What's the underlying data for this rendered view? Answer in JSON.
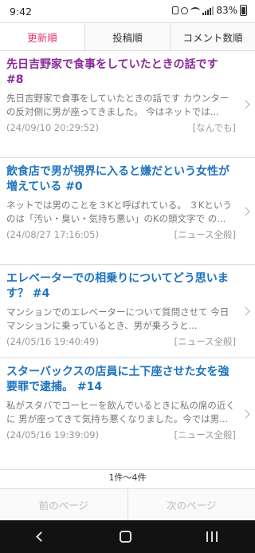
{
  "status": {
    "time": "9:42",
    "battery": "83%",
    "icons": [
      "notification-icon",
      "alarm-icon",
      "wifi-icon",
      "signal-icon",
      "battery-icon"
    ]
  },
  "tabs": [
    {
      "label": "更新順",
      "active": true
    },
    {
      "label": "投稿順",
      "active": false
    },
    {
      "label": "コメント数順",
      "active": false
    }
  ],
  "items": [
    {
      "title": "先日吉野家で食事をしていたときの話です #8",
      "body": "先日吉野家で食事をしていたときの話です カウンターの反対側に男が座ってきました。 今はネットでは...",
      "date": "(24/09/10 20:29:52)",
      "category": "[なんでも]"
    },
    {
      "title": "飲食店で男が視界に入ると嫌だという女性が増えている #0",
      "body": "ネットでは男のことを３Kと呼ばれている。 ３Kというのは「汚い・臭い・気持ち悪い」のKの頭文字で の...",
      "date": "(24/08/27 17:16:05)",
      "category": "[ニュース全般]"
    },
    {
      "title": "エレベーターでの相乗りについてどう思います？ #4",
      "body": "マンションでのエレベーターについて質問させて 今日マンションに乗っているとき、男が乗ろうと...",
      "date": "(24/05/16 19:40:49)",
      "category": "[ニュース全般]"
    },
    {
      "title": "スターバックスの店員に土下座させた女を強要罪で逮捕。 #14",
      "body": "私がスタバでコーヒーを飲んでいるときに私の席の近くに 男が座ってきて気持ち悪くなりました。今では男...",
      "date": "(24/05/16 19:39:09)",
      "category": "[ニュース全般]"
    }
  ],
  "count_label": "1件～4件",
  "pager": {
    "prev": "前のページ",
    "next": "次のページ"
  },
  "colors": {
    "active_tab": "#e0336e",
    "visited_title": "#8a2a9a",
    "link_title": "#1e73be",
    "nav_bar": "#121212"
  }
}
